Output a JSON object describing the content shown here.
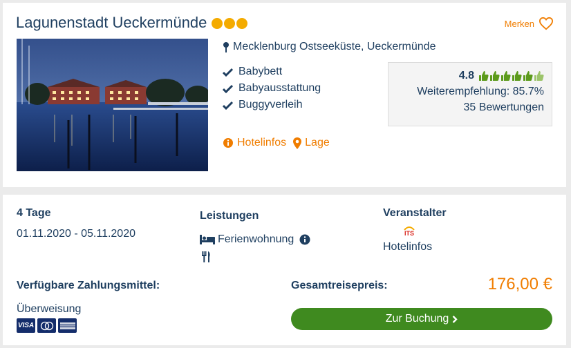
{
  "hotel": {
    "title": "Lagunenstadt Ueckermünde",
    "stars": 3,
    "favorite_label": "Merken",
    "location": "Mecklenburg Ostseeküste, Ueckermünde",
    "features": [
      "Babybett",
      "Babyausstattung",
      "Buggyverleih"
    ],
    "links": {
      "hotelinfo": "Hotelinfos",
      "lage": "Lage"
    },
    "rating": {
      "score": "4.8",
      "thumbs_filled": 5.5,
      "thumbs_total": 6,
      "recommendation": "Weiterempfehlung: 85.7%",
      "reviews": "35 Bewertungen"
    }
  },
  "booking": {
    "duration_label": "4 Tage",
    "dates": "01.11.2020 - 05.11.2020",
    "services_label": "Leistungen",
    "accommodation": "Ferienwohnung",
    "operator_label": "Veranstalter",
    "operator_logo": "ITS",
    "operator_link": "Hotelinfos",
    "payment_label": "Verfügbare Zahlungsmittel:",
    "payment_method": "Überweisung",
    "payment_icons": [
      "VISA",
      "Mastercard",
      "American Express"
    ],
    "total_label": "Gesamtreisepreis:",
    "price": "176,00 €",
    "book_button": "Zur Buchung"
  },
  "colors": {
    "accent": "#f07d00",
    "text": "#1f3f60",
    "button": "#3f8a1f",
    "star": "#f4ab00",
    "thumb": "#5c9a1b"
  }
}
